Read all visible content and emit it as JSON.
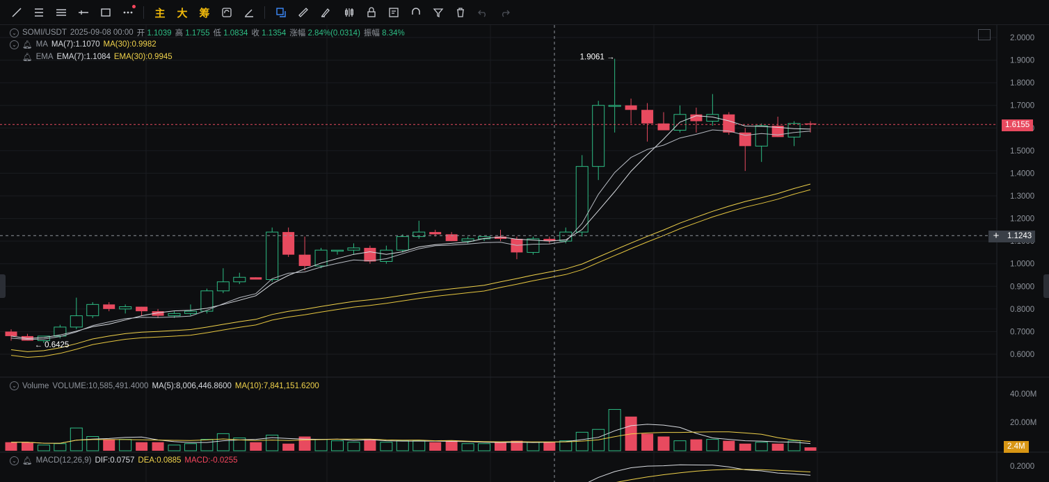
{
  "toolbar": {
    "tools": [
      {
        "name": "trend-line-tool-icon",
        "label": ""
      },
      {
        "name": "horizontal-lines-tool-icon",
        "label": ""
      },
      {
        "name": "parallel-channel-tool-icon",
        "label": ""
      },
      {
        "name": "horizontal-ray-tool-icon",
        "label": ""
      },
      {
        "name": "rectangle-tool-icon",
        "label": ""
      },
      {
        "name": "more-tools-icon",
        "label": ""
      }
    ],
    "cn_buttons": [
      "主",
      "大",
      "筹"
    ],
    "right_tools": [
      "refresh-icon",
      "magic-pen-icon",
      "layers-icon",
      "ruler-icon",
      "marker-icon",
      "candles-icon",
      "lock-icon",
      "note-icon",
      "magnet-icon",
      "filter-icon",
      "trash-icon",
      "undo-icon",
      "redo-icon"
    ]
  },
  "header": {
    "symbol": "SOMI/USDT",
    "datetime": "2025-09-08 00:00",
    "open_label": "开",
    "open": "1.1039",
    "high_label": "高",
    "high": "1.1755",
    "low_label": "低",
    "low": "1.0834",
    "close_label": "收",
    "close": "1.1354",
    "change_label": "涨幅",
    "change": "2.84%(0.0314)",
    "amp_label": "振幅",
    "amp": "8.34%"
  },
  "ma": {
    "label": "MA",
    "ma7": "MA(7):1.1070",
    "ma30": "MA(30):0.9982"
  },
  "ema": {
    "label": "EMA",
    "ema7": "EMA(7):1.1084",
    "ema30": "EMA(30):0.9945"
  },
  "volume_info": {
    "label": "Volume",
    "volume": "VOLUME:10,585,491.4000",
    "ma5": "MA(5):8,006,446.8600",
    "ma10": "MA(10):7,841,151.6200"
  },
  "macd_info": {
    "label": "MACD(12,26,9)",
    "dif": "DIF:0.0757",
    "dea": "DEA:0.0885",
    "macd": "MACD:-0.0255"
  },
  "price_axis": [
    "2.0000",
    "1.9000",
    "1.8000",
    "1.7000",
    "1.6000",
    "1.5000",
    "1.4000",
    "1.3000",
    "1.2000",
    "1.1000",
    "1.0000",
    "0.9000",
    "0.8000",
    "0.7000",
    "0.6000"
  ],
  "current_price": "1.6155",
  "crosshair_price": "1.1243",
  "high_annotation": "1.9061",
  "low_annotation": "0.6425",
  "volume_axis": [
    "40.00M",
    "20.00M"
  ],
  "current_volume": "2.4M",
  "macd_axis": [
    "0.2000"
  ],
  "colors": {
    "up": "#2ebd85",
    "down": "#e84a5f",
    "ma_white": "#d9dce1",
    "ma_yellow": "#f0d24b",
    "accent": "#f0b90b"
  },
  "chart_data": {
    "type": "candlestick",
    "ohlc": [
      [
        0.7,
        0.71,
        0.66,
        0.68
      ],
      [
        0.68,
        0.69,
        0.66,
        0.66
      ],
      [
        0.66,
        0.68,
        0.65,
        0.68
      ],
      [
        0.68,
        0.73,
        0.67,
        0.72
      ],
      [
        0.72,
        0.85,
        0.71,
        0.77
      ],
      [
        0.77,
        0.83,
        0.76,
        0.82
      ],
      [
        0.82,
        0.83,
        0.79,
        0.8
      ],
      [
        0.8,
        0.82,
        0.78,
        0.81
      ],
      [
        0.81,
        0.81,
        0.77,
        0.79
      ],
      [
        0.79,
        0.8,
        0.76,
        0.77
      ],
      [
        0.77,
        0.79,
        0.76,
        0.78
      ],
      [
        0.78,
        0.82,
        0.77,
        0.79
      ],
      [
        0.79,
        0.89,
        0.78,
        0.88
      ],
      [
        0.88,
        0.98,
        0.87,
        0.92
      ],
      [
        0.92,
        0.96,
        0.91,
        0.94
      ],
      [
        0.94,
        0.94,
        0.93,
        0.93
      ],
      [
        0.93,
        1.16,
        0.92,
        1.14
      ],
      [
        1.14,
        1.16,
        1.03,
        1.04
      ],
      [
        1.04,
        1.12,
        0.97,
        0.99
      ],
      [
        0.99,
        1.07,
        0.98,
        1.06
      ],
      [
        1.06,
        1.06,
        1.04,
        1.06
      ],
      [
        1.06,
        1.09,
        1.04,
        1.07
      ],
      [
        1.07,
        1.08,
        1.0,
        1.01
      ],
      [
        1.01,
        1.08,
        1.0,
        1.06
      ],
      [
        1.06,
        1.13,
        1.05,
        1.12
      ],
      [
        1.12,
        1.19,
        1.11,
        1.14
      ],
      [
        1.14,
        1.15,
        1.12,
        1.13
      ],
      [
        1.13,
        1.14,
        1.1,
        1.1
      ],
      [
        1.1,
        1.12,
        1.09,
        1.11
      ],
      [
        1.11,
        1.12,
        1.1,
        1.12
      ],
      [
        1.12,
        1.15,
        1.1,
        1.11
      ],
      [
        1.11,
        1.12,
        1.02,
        1.05
      ],
      [
        1.05,
        1.12,
        1.04,
        1.11
      ],
      [
        1.11,
        1.12,
        1.09,
        1.1
      ],
      [
        1.1,
        1.16,
        1.09,
        1.14
      ],
      [
        1.14,
        1.48,
        1.12,
        1.43
      ],
      [
        1.43,
        1.72,
        1.37,
        1.7
      ],
      [
        1.7,
        1.9061,
        1.58,
        1.7
      ],
      [
        1.7,
        1.73,
        1.62,
        1.68
      ],
      [
        1.68,
        1.71,
        1.54,
        1.62
      ],
      [
        1.62,
        1.67,
        1.59,
        1.59
      ],
      [
        1.59,
        1.7,
        1.58,
        1.66
      ],
      [
        1.66,
        1.69,
        1.58,
        1.63
      ],
      [
        1.63,
        1.75,
        1.61,
        1.66
      ],
      [
        1.66,
        1.67,
        1.57,
        1.58
      ],
      [
        1.58,
        1.6,
        1.41,
        1.52
      ],
      [
        1.52,
        1.62,
        1.45,
        1.61
      ],
      [
        1.61,
        1.65,
        1.56,
        1.56
      ],
      [
        1.56,
        1.63,
        1.52,
        1.62
      ],
      [
        1.62,
        1.63,
        1.58,
        1.6155
      ]
    ],
    "volume_m": [
      6,
      6,
      4,
      5,
      16,
      10,
      8,
      8,
      6,
      6,
      4,
      5,
      8,
      12,
      9,
      6,
      11,
      5,
      10,
      8,
      7,
      6,
      8,
      6,
      7,
      7,
      6,
      7,
      5,
      5,
      6,
      7,
      6,
      6,
      7,
      13,
      15,
      29,
      24,
      12,
      10,
      7,
      8,
      8,
      7,
      5,
      6,
      5,
      7,
      2.4
    ],
    "ylim": [
      0.55,
      2.05
    ]
  }
}
